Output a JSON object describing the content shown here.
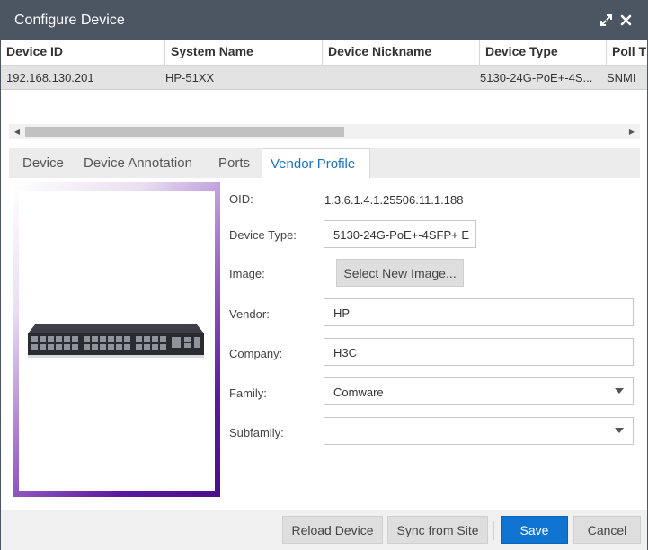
{
  "window": {
    "title": "Configure Device",
    "icons": [
      "expand-icon",
      "close-icon"
    ]
  },
  "grid": {
    "columns": [
      "Device ID",
      "System Name",
      "Device Nickname",
      "Device Type",
      "Poll T"
    ],
    "rows": [
      [
        "192.168.130.201",
        "HP-51XX",
        "",
        "5130-24G-PoE+-4S...",
        "SNMI"
      ]
    ]
  },
  "tabs": [
    {
      "label": "Device",
      "active": false
    },
    {
      "label": "Device Annotation",
      "active": false
    },
    {
      "label": "Ports",
      "active": false
    },
    {
      "label": "Vendor Profile",
      "active": true
    }
  ],
  "vendor_profile": {
    "oid_label": "OID:",
    "oid_value": "1.3.6.1.4.1.25506.11.1.188",
    "device_type_label": "Device Type:",
    "device_type_value": "5130-24G-PoE+-4SFP+ E",
    "image_label": "Image:",
    "select_image_button": "Select New Image...",
    "vendor_label": "Vendor:",
    "vendor_value": "HP",
    "company_label": "Company:",
    "company_value": "H3C",
    "family_label": "Family:",
    "family_value": "Comware",
    "subfamily_label": "Subfamily:",
    "subfamily_value": ""
  },
  "footer": {
    "reload_label": "Reload Device",
    "sync_label": "Sync from Site",
    "save_label": "Save",
    "cancel_label": "Cancel"
  },
  "colors": {
    "titlebar": "#4b5662",
    "primary_button": "#0f74d1",
    "active_tab_text": "#1a73c8",
    "image_frame_accent": "#5b1aa0"
  }
}
